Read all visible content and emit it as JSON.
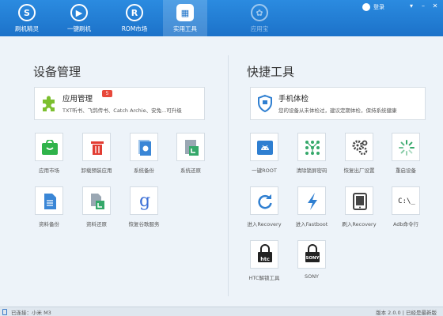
{
  "nav": [
    {
      "label": "刷机精灵",
      "glyph": "S"
    },
    {
      "label": "一键刷机",
      "glyph": "▶"
    },
    {
      "label": "ROM市场",
      "glyph": "R"
    },
    {
      "label": "实用工具",
      "glyph": "▦"
    },
    {
      "label": "应用宝",
      "glyph": "✿"
    }
  ],
  "header": {
    "login_label": "登录",
    "window_controls": [
      "▾",
      "–",
      "✕"
    ]
  },
  "left": {
    "title": "设备管理",
    "card": {
      "title": "应用管理",
      "badge": "5",
      "desc": "TXT听书、飞鸽传书、Catch Archie、安兔...可升级"
    },
    "tools": [
      {
        "label": "应用市场",
        "icon": "app-market-icon",
        "color": "#2fb34a"
      },
      {
        "label": "卸载预装应用",
        "icon": "uninstall-icon",
        "color": "#e23c32"
      },
      {
        "label": "系统备份",
        "icon": "system-backup-icon",
        "color": "#3a86d6"
      },
      {
        "label": "系统还原",
        "icon": "system-restore-icon",
        "color": "#35a86a"
      },
      {
        "label": "资料备份",
        "icon": "data-backup-icon",
        "color": "#3a86d6"
      },
      {
        "label": "资料还原",
        "icon": "data-restore-icon",
        "color": "#35a86a"
      },
      {
        "label": "恢复谷歌服务",
        "icon": "google-icon",
        "color": "#3b6fd6"
      }
    ]
  },
  "right": {
    "title": "快捷工具",
    "card": {
      "title": "手机体检",
      "desc": "您的设备从未体检过，建议定期体检，保持系统健康"
    },
    "tools": [
      {
        "label": "一键ROOT",
        "icon": "android-root-icon",
        "color": "#2f7fd1"
      },
      {
        "label": "清除锁屏密码",
        "icon": "pattern-lock-icon",
        "color": "#35a86a"
      },
      {
        "label": "恢复出厂设置",
        "icon": "gears-icon",
        "color": "#444444"
      },
      {
        "label": "重启设备",
        "icon": "loading-icon",
        "color": "#35a86a"
      },
      {
        "label": "进入Recovery",
        "icon": "refresh-icon",
        "color": "#2f7fd1"
      },
      {
        "label": "进入Fastboot",
        "icon": "lightning-icon",
        "color": "#2f7fd1"
      },
      {
        "label": "刷入Recovery",
        "icon": "tablet-icon",
        "color": "#444444"
      },
      {
        "label": "Adb命令行",
        "icon": "terminal-icon",
        "color": "#222222",
        "glyph": "C:\\_"
      },
      {
        "label": "HTC解锁工具",
        "icon": "htc-lock-icon",
        "color": "#222222",
        "glyph": "htc"
      },
      {
        "label": "SONY",
        "icon": "sony-lock-icon",
        "color": "#222222",
        "glyph": "SONY"
      }
    ]
  },
  "status": {
    "left": "已连接：小米 M3",
    "right": "版本 2.0.0  |  已经是最新版"
  }
}
